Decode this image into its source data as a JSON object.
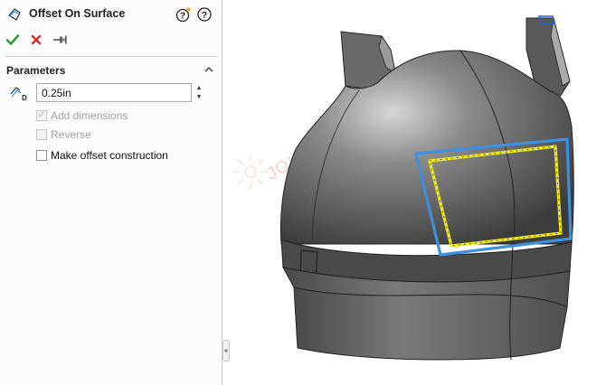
{
  "feature": {
    "title": "Offset On Surface",
    "icon": "offset-on-surface-icon",
    "help_icons": [
      "help-with-sparkle-icon",
      "help-icon"
    ]
  },
  "actions": {
    "ok_icon": "check-icon",
    "cancel_icon": "close-icon",
    "pin_icon": "pushpin-icon"
  },
  "parameters": {
    "title": "Parameters",
    "collapse_icon": "chevron-up-icon",
    "distance_icon": "distance-icon",
    "distance_value": "0.25in",
    "add_dimensions": {
      "label": "Add dimensions",
      "checked": true,
      "enabled": false
    },
    "reverse": {
      "label": "Reverse",
      "checked": false,
      "enabled": false
    },
    "make_offset_construction": {
      "label": "Make offset construction",
      "checked": false,
      "enabled": true
    }
  },
  "colors": {
    "ok_green": "#2e9e33",
    "cancel_red": "#d42a2a",
    "offset_yellow": "#f2ea1f",
    "edge_blue": "#3d8fe0",
    "model_gray": "#5e5e5e"
  },
  "viewport": {
    "watermark_text": "JOYSIN 卓盈信息 sw-joysin"
  }
}
